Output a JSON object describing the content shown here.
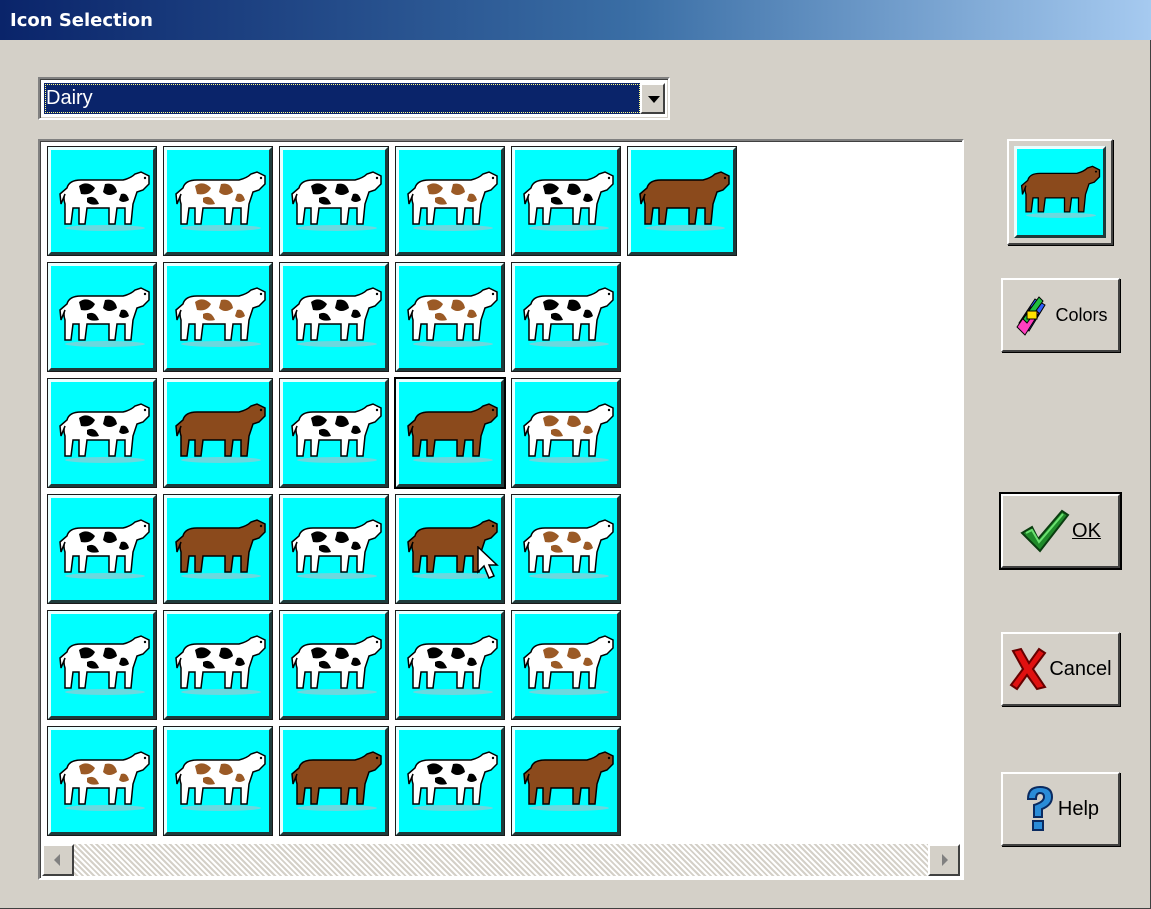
{
  "window": {
    "title": "Icon Selection"
  },
  "category_select": {
    "selected_value": "Dairy"
  },
  "icon_grid": {
    "rows": [
      [
        {
          "icon": "cow-holstein-icon",
          "color": "black-white"
        },
        {
          "icon": "cow-guernsey-icon",
          "color": "brown-white"
        },
        {
          "icon": "cow-holstein-icon",
          "color": "black-white"
        },
        {
          "icon": "cow-ayrshire-icon",
          "color": "brown-white"
        },
        {
          "icon": "cow-holstein-icon",
          "color": "black-white"
        },
        {
          "icon": "cow-jersey-icon",
          "color": "brown"
        }
      ],
      [
        {
          "icon": "cow-holstein-icon",
          "color": "black-white"
        },
        {
          "icon": "cow-guernsey-icon",
          "color": "brown-white"
        },
        {
          "icon": "cow-holstein-icon",
          "color": "black-white"
        },
        {
          "icon": "cow-ayrshire-icon",
          "color": "brown-white"
        },
        {
          "icon": "cow-holstein-icon",
          "color": "black-white"
        }
      ],
      [
        {
          "icon": "cow-holstein-icon",
          "color": "black-white"
        },
        {
          "icon": "cow-jersey-icon",
          "color": "brown"
        },
        {
          "icon": "cow-holstein-icon",
          "color": "black-white"
        },
        {
          "icon": "cow-jersey-icon",
          "color": "brown",
          "selected": true
        },
        {
          "icon": "cow-guernsey-icon",
          "color": "brown-white"
        }
      ],
      [
        {
          "icon": "cow-holstein-icon",
          "color": "black-white"
        },
        {
          "icon": "cow-jersey-icon",
          "color": "brown"
        },
        {
          "icon": "cow-holstein-icon",
          "color": "black-white"
        },
        {
          "icon": "cow-jersey-icon",
          "color": "brown"
        },
        {
          "icon": "cow-guernsey-icon",
          "color": "brown-white"
        }
      ],
      [
        {
          "icon": "cow-holstein-icon",
          "color": "black-white"
        },
        {
          "icon": "cow-cartoon-icon",
          "color": "black-white"
        },
        {
          "icon": "cow-holstein-icon",
          "color": "black-white"
        },
        {
          "icon": "cow-holstein-icon",
          "color": "black-white"
        },
        {
          "icon": "cow-ayrshire-icon",
          "color": "brown-white"
        }
      ],
      [
        {
          "icon": "cow-guernsey-icon",
          "color": "brown-white"
        },
        {
          "icon": "cow-cartoon-icon",
          "color": "brown-white"
        },
        {
          "icon": "cow-jersey-icon",
          "color": "brown"
        },
        {
          "icon": "cow-holstein-icon",
          "color": "black-white"
        },
        {
          "icon": "cow-jersey-icon",
          "color": "brown"
        }
      ]
    ]
  },
  "preview": {
    "icon": "cow-jersey-icon",
    "color": "brown"
  },
  "buttons": {
    "colors": "Colors",
    "ok": "OK",
    "cancel": "Cancel",
    "help": "Help"
  },
  "colors": {
    "tile_bg": "#00ffff",
    "title_bar": "#0a246a",
    "dialog_bg": "#d4d0c8"
  }
}
